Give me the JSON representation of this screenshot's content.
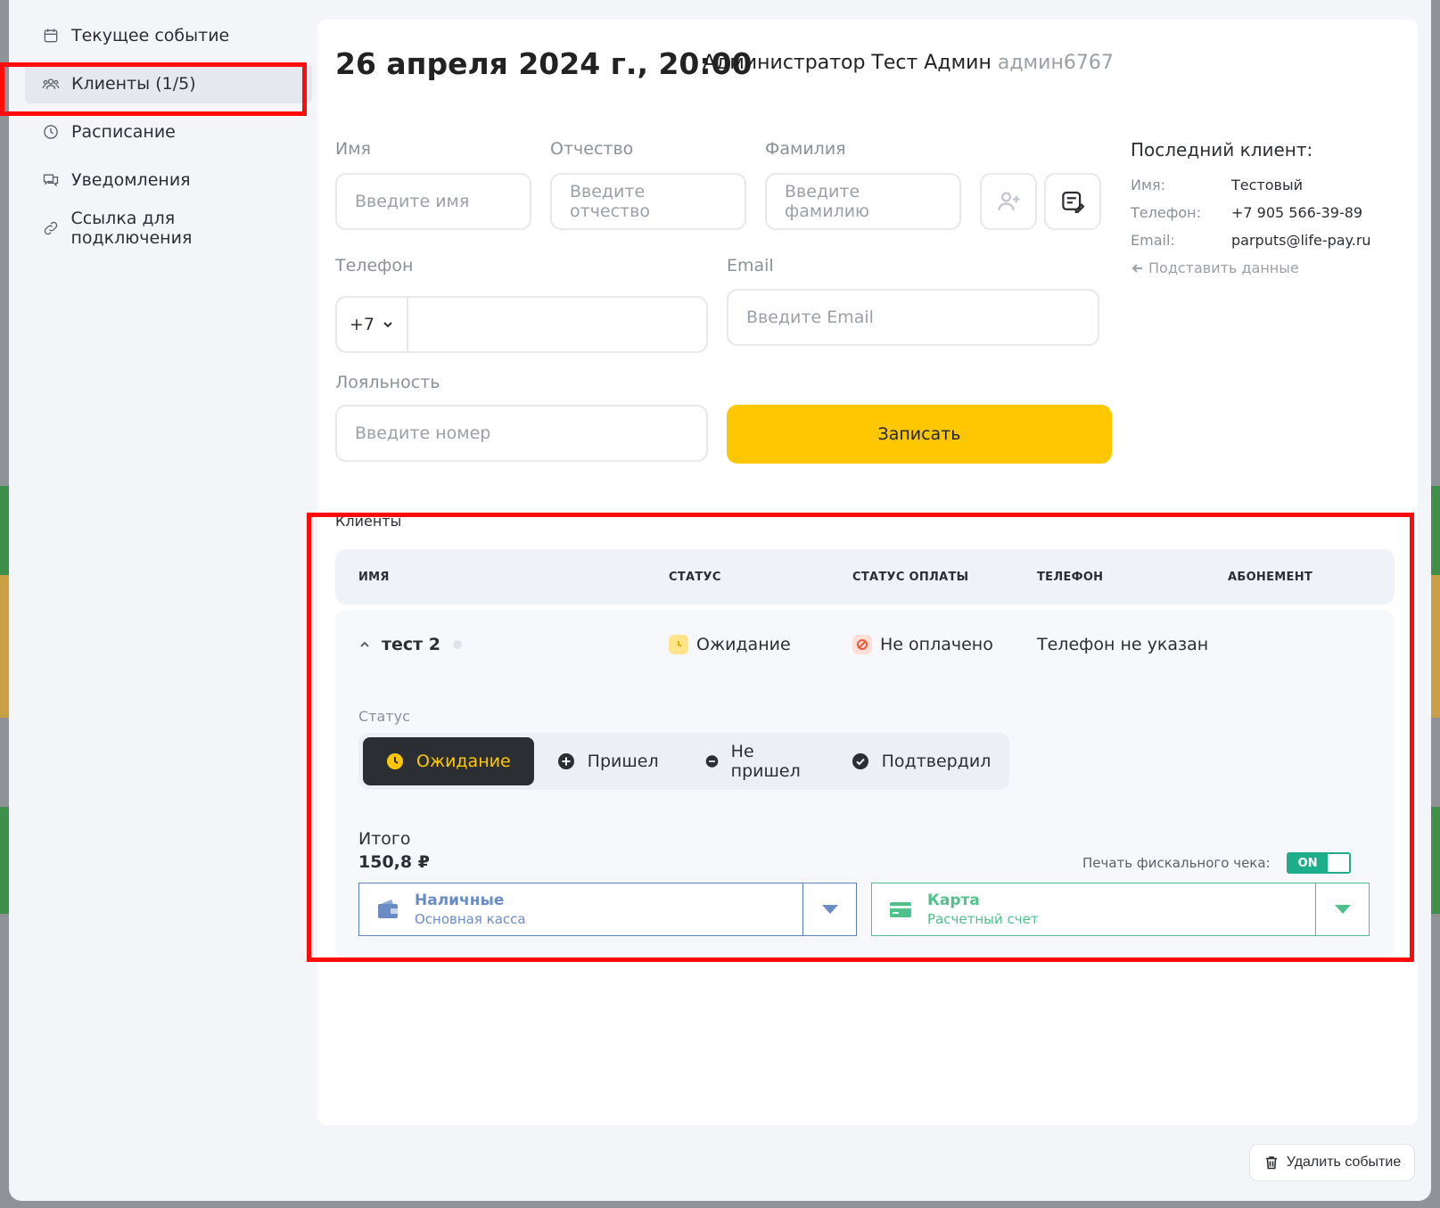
{
  "sidebar": {
    "items": [
      {
        "label": "Текущее событие",
        "icon": "calendar-icon"
      },
      {
        "label": "Клиенты (1/5)",
        "icon": "users-icon"
      },
      {
        "label": "Расписание",
        "icon": "clock-icon"
      },
      {
        "label": "Уведомления",
        "icon": "chat-icon"
      },
      {
        "label": "Ссылка для подключения",
        "icon": "link-icon"
      }
    ],
    "active": 1
  },
  "header": {
    "datetime": "26 апреля 2024 г., 20:00",
    "admin": "Администратор Тест Админ",
    "login": "админ6767"
  },
  "form": {
    "first_name": {
      "label": "Имя",
      "placeholder": "Введите имя"
    },
    "middle_name": {
      "label": "Отчество",
      "placeholder": "Введите отчество"
    },
    "last_name": {
      "label": "Фамилия",
      "placeholder": "Введите фамилию"
    },
    "phone": {
      "label": "Телефон",
      "code": "+7",
      "value": ""
    },
    "email": {
      "label": "Email",
      "placeholder": "Введите Email"
    },
    "loyalty": {
      "label": "Лояльность",
      "placeholder": "Введите номер"
    },
    "submit_label": "Записать"
  },
  "last_client": {
    "title": "Последний клиент:",
    "name_label": "Имя:",
    "name": "Тестовый",
    "phone_label": "Телефон:",
    "phone": "+7 905 566-39-89",
    "email_label": "Email:",
    "email": "parputs@life-pay.ru",
    "fill_label": "Подставить данные"
  },
  "clients": {
    "title": "Клиенты",
    "columns": [
      "ИМЯ",
      "СТАТУС",
      "СТАТУС ОПЛАТЫ",
      "ТЕЛЕФОН",
      "АБОНЕМЕНТ"
    ],
    "rows": [
      {
        "name": "тест 2",
        "status": "Ожидание",
        "payment_status": "Не оплачено",
        "phone": "Телефон не указан",
        "subscription": ""
      }
    ]
  },
  "detail": {
    "status_label": "Статус",
    "status_options": [
      "Ожидание",
      "Пришел",
      "Не пришел",
      "Подтвердил"
    ],
    "active_status": 0,
    "total_label": "Итого",
    "total_value": "150,8 ₽",
    "fiscal_label": "Печать фискального чека:",
    "fiscal_toggle": "ON",
    "payment_cash": {
      "title": "Наличные",
      "subtitle": "Основная касса"
    },
    "payment_card": {
      "title": "Карта",
      "subtitle": "Расчетный счет"
    }
  },
  "footer": {
    "delete_label": "Удалить событие"
  },
  "colors": {
    "accent": "#ffc700",
    "highlight": "#ff0b0b",
    "success": "#1fae8b",
    "cash": "#6a8cc4",
    "card": "#4fc28b"
  }
}
